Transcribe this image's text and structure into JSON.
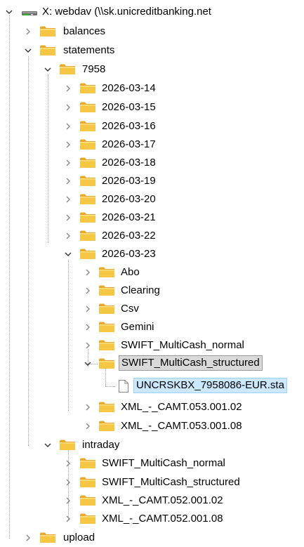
{
  "tree": {
    "drive": {
      "label": "X: webdav (\\\\sk.unicreditbanking.net",
      "icon": "network-drive-icon"
    },
    "items": [
      {
        "label": "balances",
        "icon": "folder-icon",
        "expand": "collapsed"
      },
      {
        "label": "statements",
        "icon": "folder-icon",
        "expand": "expanded"
      },
      {
        "label": "7958",
        "icon": "folder-icon",
        "expand": "expanded"
      },
      {
        "label": "2026-03-14",
        "icon": "folder-icon",
        "expand": "collapsed"
      },
      {
        "label": "2026-03-15",
        "icon": "folder-icon",
        "expand": "collapsed"
      },
      {
        "label": "2026-03-16",
        "icon": "folder-icon",
        "expand": "collapsed"
      },
      {
        "label": "2026-03-17",
        "icon": "folder-icon",
        "expand": "collapsed"
      },
      {
        "label": "2026-03-18",
        "icon": "folder-icon",
        "expand": "collapsed"
      },
      {
        "label": "2026-03-19",
        "icon": "folder-icon",
        "expand": "collapsed"
      },
      {
        "label": "2026-03-20",
        "icon": "folder-icon",
        "expand": "collapsed"
      },
      {
        "label": "2026-03-21",
        "icon": "folder-icon",
        "expand": "collapsed"
      },
      {
        "label": "2026-03-22",
        "icon": "folder-icon",
        "expand": "collapsed"
      },
      {
        "label": "2026-03-23",
        "icon": "folder-icon",
        "expand": "expanded"
      },
      {
        "label": "Abo",
        "icon": "folder-icon",
        "expand": "collapsed"
      },
      {
        "label": "Clearing",
        "icon": "folder-icon",
        "expand": "collapsed"
      },
      {
        "label": "Csv",
        "icon": "folder-icon",
        "expand": "collapsed"
      },
      {
        "label": "Gemini",
        "icon": "folder-icon",
        "expand": "collapsed"
      },
      {
        "label": "SWIFT_MultiCash_normal",
        "icon": "folder-icon",
        "expand": "collapsed"
      },
      {
        "label": "SWIFT_MultiCash_structured",
        "icon": "folder-icon",
        "expand": "expanded",
        "state": "selected-inactive"
      },
      {
        "label": "UNCRSKBX_7958086-EUR.sta",
        "icon": "file-icon",
        "expand": "none",
        "state": "selected-active"
      },
      {
        "label": "XML_-_CAMT.053.001.02",
        "icon": "folder-icon",
        "expand": "collapsed"
      },
      {
        "label": "XML_-_CAMT.053.001.08",
        "icon": "folder-icon",
        "expand": "collapsed"
      },
      {
        "label": "intraday",
        "icon": "folder-icon",
        "expand": "expanded"
      },
      {
        "label": "SWIFT_MultiCash_normal",
        "icon": "folder-icon",
        "expand": "collapsed"
      },
      {
        "label": "SWIFT_MultiCash_structured",
        "icon": "folder-icon",
        "expand": "collapsed"
      },
      {
        "label": "XML_-_CAMT.052.001.02",
        "icon": "folder-icon",
        "expand": "collapsed"
      },
      {
        "label": "XML_-_CAMT.052.001.08",
        "icon": "folder-icon",
        "expand": "collapsed"
      },
      {
        "label": "upload",
        "icon": "folder-icon",
        "expand": "collapsed"
      }
    ]
  },
  "colors": {
    "folder_body": "#f6c744",
    "folder_tab": "#e8a82a",
    "selected_inactive_bg": "#d9d9d9",
    "selected_active_bg": "#cce8ff",
    "tree_line": "#a0a0a0"
  }
}
